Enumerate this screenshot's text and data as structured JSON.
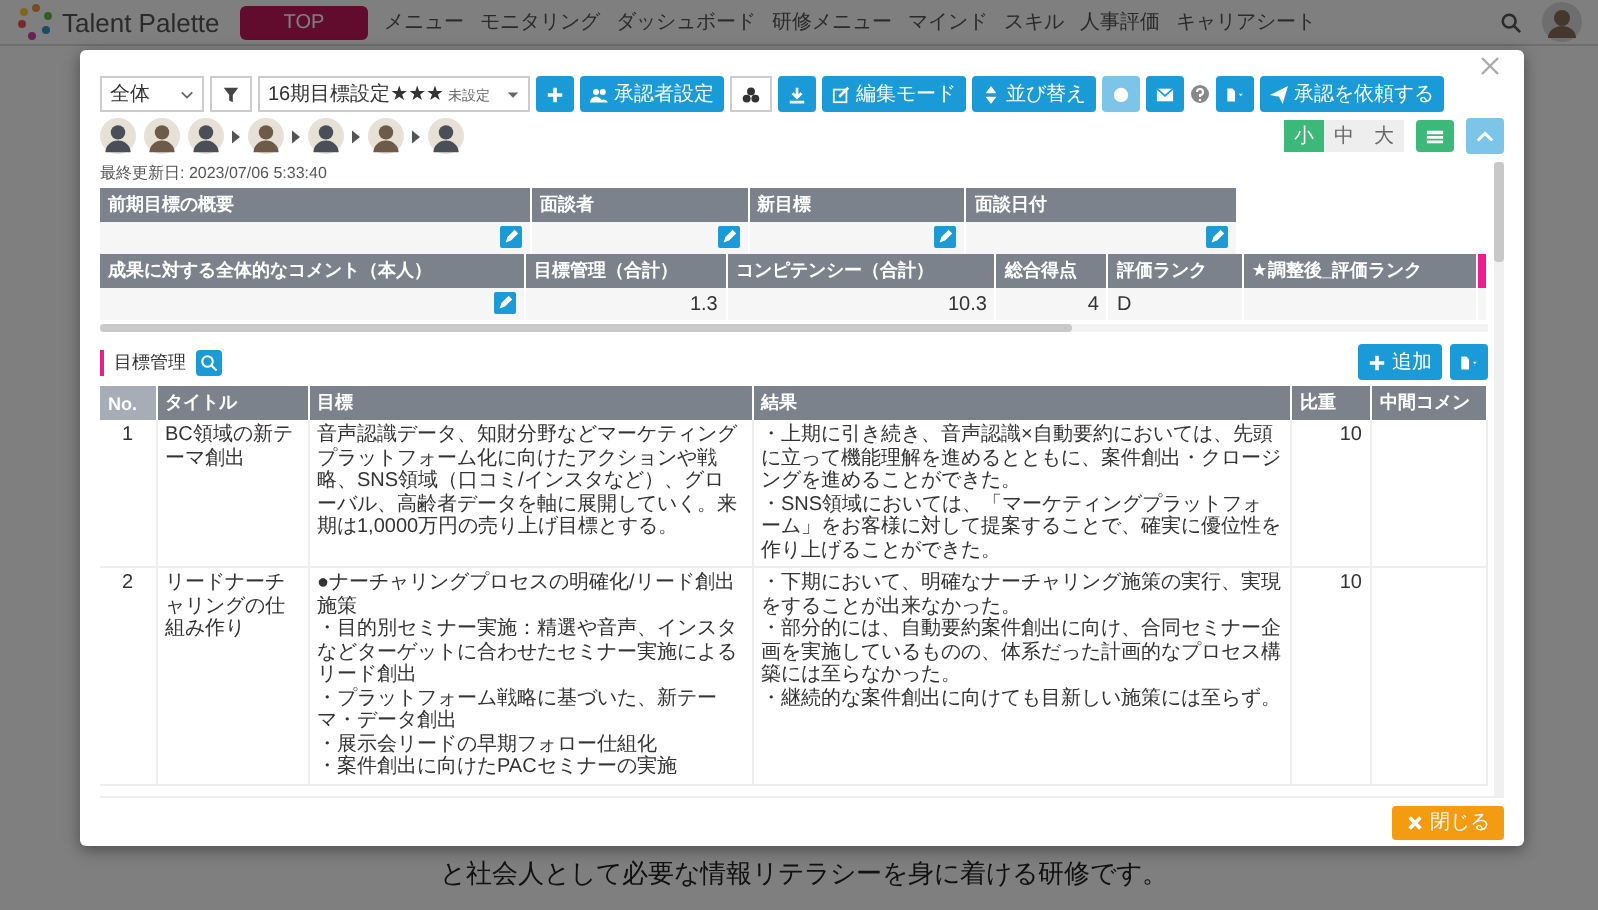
{
  "app": {
    "logo": "Talent Palette",
    "nav": [
      {
        "label": "TOP",
        "selected": true
      },
      {
        "label": "メニュー",
        "selected": false
      },
      {
        "label": "モニタリング",
        "selected": false
      },
      {
        "label": "ダッシュボード",
        "selected": false
      },
      {
        "label": "研修メニュー",
        "selected": false
      },
      {
        "label": "マインド",
        "selected": false
      },
      {
        "label": "スキル",
        "selected": false
      },
      {
        "label": "人事評価",
        "selected": false
      },
      {
        "label": "キャリアシート",
        "selected": false
      }
    ],
    "background_text": "と社会人として必要な情報リテラシーを身に着ける研修です。"
  },
  "modal": {
    "toolbar": {
      "scope": "全体",
      "period": "16期目標設定★★★",
      "period_tag": "未設定",
      "approver_button": "承認者設定",
      "edit_button": "編集モード",
      "sort_button": "並び替え",
      "request_button": "承認を依頼する"
    },
    "size_options": [
      {
        "label": "小",
        "selected": true
      },
      {
        "label": "中",
        "selected": false
      },
      {
        "label": "大",
        "selected": false
      }
    ],
    "last_updated": "最終更新日: 2023/07/06 5:33:40",
    "summary_tables": [
      {
        "columns": [
          "前期目標の概要",
          "面談者",
          "新目標",
          "面談日付"
        ],
        "cells": [
          {
            "kind": "edit"
          },
          {
            "kind": "edit"
          },
          {
            "kind": "edit"
          },
          {
            "kind": "edit"
          }
        ]
      },
      {
        "columns": [
          "成果に対する全体的なコメント（本人）",
          "目標管理（合計）",
          "コンピテンシー（合計）",
          "総合得点",
          "評価ランク",
          "★調整後_評価ランク"
        ],
        "cells": [
          {
            "kind": "edit"
          },
          {
            "kind": "number",
            "value": "1.3"
          },
          {
            "kind": "number",
            "value": "10.3"
          },
          {
            "kind": "number",
            "value": "4"
          },
          {
            "kind": "text",
            "value": "D"
          },
          {
            "kind": "blank"
          }
        ]
      }
    ],
    "goals": {
      "title": "目標管理",
      "add_button": "追加",
      "columns": [
        "No.",
        "タイトル",
        "目標",
        "結果",
        "比重",
        "中間コメン"
      ],
      "rows": [
        {
          "no": "1",
          "title": "BC領域の新テーマ創出",
          "goal": [
            "音声認識データ、知財分野などマーケティングプラットフォーム化に向けたアクションや戦略、SNS領域（口コミ/インスタなど）、グローバル、高齢者データを軸に展開していく。来期は1,0000万円の売り上げ目標とする。"
          ],
          "result": [
            "・上期に引き続き、音声認識×自動要約においては、先頭に立って機能理解を進めるとともに、案件創出・クロージングを進めることができた。",
            "・SNS領域においては、「マーケティングプラットフォーム」をお客様に対して提案することで、確実に優位性を作り上げることができた。"
          ],
          "weight": "10"
        },
        {
          "no": "2",
          "title": "リードナーチャリングの仕組み作り",
          "goal": [
            "●ナーチャリングプロセスの明確化/リード創出施策",
            "・目的別セミナー実施：精選や音声、インスタなどターゲットに合わせたセミナー実施によるリード創出",
            "・プラットフォーム戦略に基づいた、新テーマ・データ創出",
            "・展示会リードの早期フォロー仕組化",
            "・案件創出に向けたPACセミナーの実施"
          ],
          "result": [
            "・下期において、明確なナーチャリング施策の実行、実現をすることが出来なかった。",
            "・部分的には、自動要約案件創出に向け、合同セミナー企画を実施しているものの、体系だった計画的なプロセス構築には至らなかった。",
            "・継続的な案件創出に向けても目新しい施策には至らず。"
          ],
          "weight": "10"
        }
      ]
    },
    "close_button": "閉じる"
  }
}
